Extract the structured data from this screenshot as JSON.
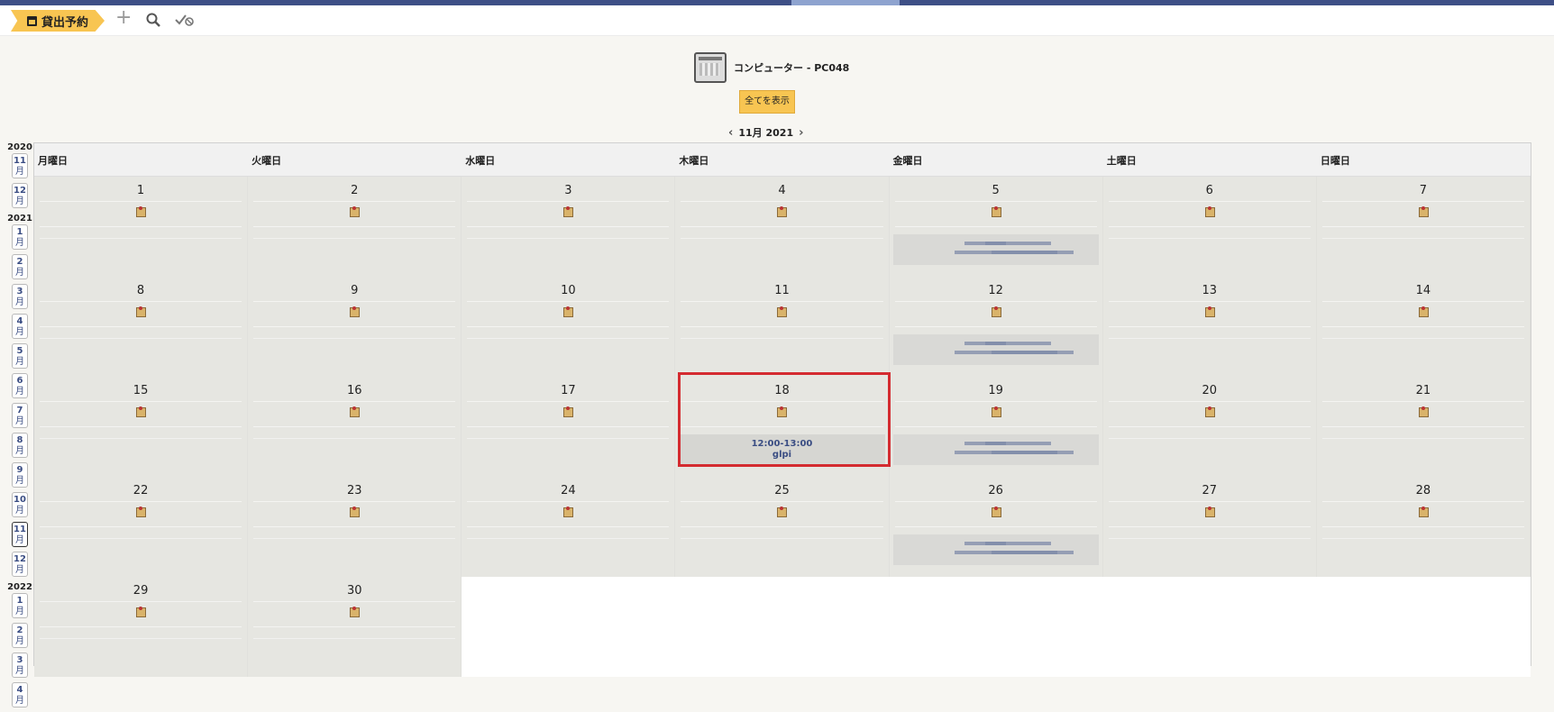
{
  "toolbar": {
    "breadcrumb": "貸出予約",
    "add_icon": "plus-icon",
    "search_icon": "search-icon",
    "check_icon": "checklist-icon"
  },
  "resource": {
    "title": "コンピューター - PC048",
    "show_all": "全てを表示"
  },
  "nav": {
    "month_label": "11月 2021"
  },
  "sidebar": [
    {
      "year": "2020",
      "months": [
        "11",
        "12"
      ]
    },
    {
      "year": "2021",
      "months": [
        "1",
        "2",
        "3",
        "4",
        "5",
        "6",
        "7",
        "8",
        "9",
        "10",
        "11",
        "12"
      ]
    },
    {
      "year": "2022",
      "months": [
        "1",
        "2",
        "3",
        "4"
      ]
    }
  ],
  "month_suffix": "月",
  "current_month": "2021-11",
  "weekdays": [
    "月曜日",
    "火曜日",
    "水曜日",
    "木曜日",
    "金曜日",
    "土曜日",
    "日曜日"
  ],
  "weeks": [
    [
      "1",
      "2",
      "3",
      "4",
      "5",
      "6",
      "7"
    ],
    [
      "8",
      "9",
      "10",
      "11",
      "12",
      "13",
      "14"
    ],
    [
      "15",
      "16",
      "17",
      "18",
      "19",
      "20",
      "21"
    ],
    [
      "22",
      "23",
      "24",
      "25",
      "26",
      "27",
      "28"
    ],
    [
      "29",
      "30",
      "",
      "",
      "",
      "",
      ""
    ]
  ],
  "reservation": {
    "day": "18",
    "time": "12:00-13:00",
    "user": "glpi"
  },
  "blurred_days": [
    "5",
    "12",
    "19",
    "26"
  ],
  "colors": {
    "accent": "#f8c552",
    "top_bar": "#3e4f86",
    "highlight": "#d42b30"
  }
}
